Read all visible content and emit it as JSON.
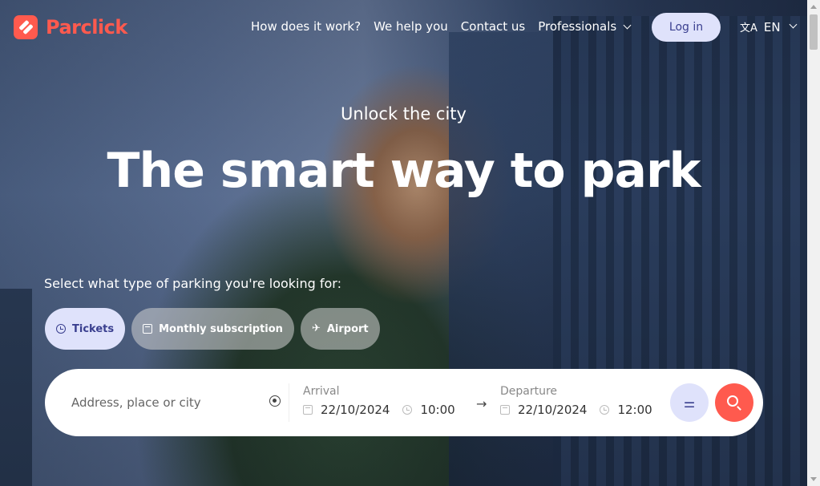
{
  "brand": {
    "name": "Parclick",
    "color": "#ff5a4e"
  },
  "nav": {
    "items": [
      "How does it work?",
      "We help you",
      "Contact us",
      "Professionals"
    ],
    "login": "Log in",
    "language": "EN"
  },
  "hero": {
    "kicker": "Unlock the city",
    "headline": "The smart way to park",
    "prompt": "Select what type of parking you're looking for:"
  },
  "parking_types": [
    {
      "label": "Tickets",
      "icon": "clock-icon",
      "active": true
    },
    {
      "label": "Monthly subscription",
      "icon": "calendar-icon",
      "active": false
    },
    {
      "label": "Airport",
      "icon": "plane-icon",
      "active": false
    }
  ],
  "search": {
    "placeholder": "Address, place or city",
    "arrival": {
      "label": "Arrival",
      "date": "22/10/2024",
      "time": "10:00"
    },
    "departure": {
      "label": "Departure",
      "date": "22/10/2024",
      "time": "12:00"
    },
    "arrow": "→"
  },
  "colors": {
    "accent": "#ff5a4e",
    "pill_active": "#dfe2fb",
    "pill_active_text": "#3a3f8f"
  }
}
